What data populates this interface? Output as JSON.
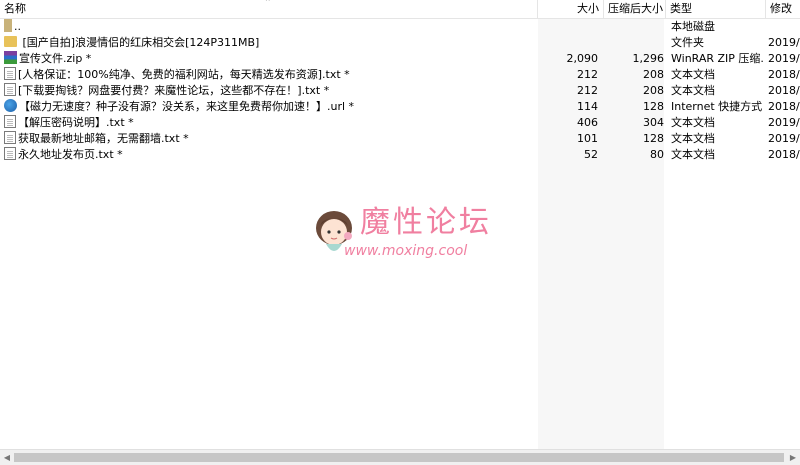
{
  "header": {
    "name": "名称",
    "size": "大小",
    "packed": "压缩后大小",
    "type": "类型",
    "modified": "修改"
  },
  "rows": [
    {
      "name": "..",
      "size": "",
      "packed": "",
      "type": "本地磁盘",
      "modified": "",
      "icon": "up-folder-icon"
    },
    {
      "name": "[国产自拍]浪漫情侣的红床相交会[124P311MB]",
      "size": "",
      "packed": "",
      "type": "文件夹",
      "modified": "2019/",
      "icon": "folder-icon"
    },
    {
      "name": "宣传文件.zip *",
      "size": "2,090",
      "packed": "1,296",
      "type": "WinRAR ZIP 压缩...",
      "modified": "2019/",
      "icon": "zip-icon"
    },
    {
      "name": "[人格保证：100%纯净、免费的福利网站，每天精选发布资源].txt *",
      "size": "212",
      "packed": "208",
      "type": "文本文档",
      "modified": "2018/",
      "icon": "text-file-icon"
    },
    {
      "name": "[下载要掏钱？网盘要付费？来魔性论坛，这些都不存在！].txt *",
      "size": "212",
      "packed": "208",
      "type": "文本文档",
      "modified": "2018/",
      "icon": "text-file-icon"
    },
    {
      "name": "【磁力无速度？种子没有源？没关系，来这里免费帮你加速！】.url *",
      "size": "114",
      "packed": "128",
      "type": "Internet 快捷方式",
      "modified": "2018/",
      "icon": "url-globe-icon"
    },
    {
      "name": "【解压密码说明】.txt *",
      "size": "406",
      "packed": "304",
      "type": "文本文档",
      "modified": "2019/",
      "icon": "text-file-icon"
    },
    {
      "name": "获取最新地址邮箱，无需翻墙.txt *",
      "size": "101",
      "packed": "128",
      "type": "文本文档",
      "modified": "2019/",
      "icon": "text-file-icon"
    },
    {
      "name": "永久地址发布页.txt *",
      "size": "52",
      "packed": "80",
      "type": "文本文档",
      "modified": "2018/",
      "icon": "text-file-icon"
    }
  ],
  "watermark": {
    "title": "魔性论坛",
    "url": "www.moxing.cool"
  }
}
